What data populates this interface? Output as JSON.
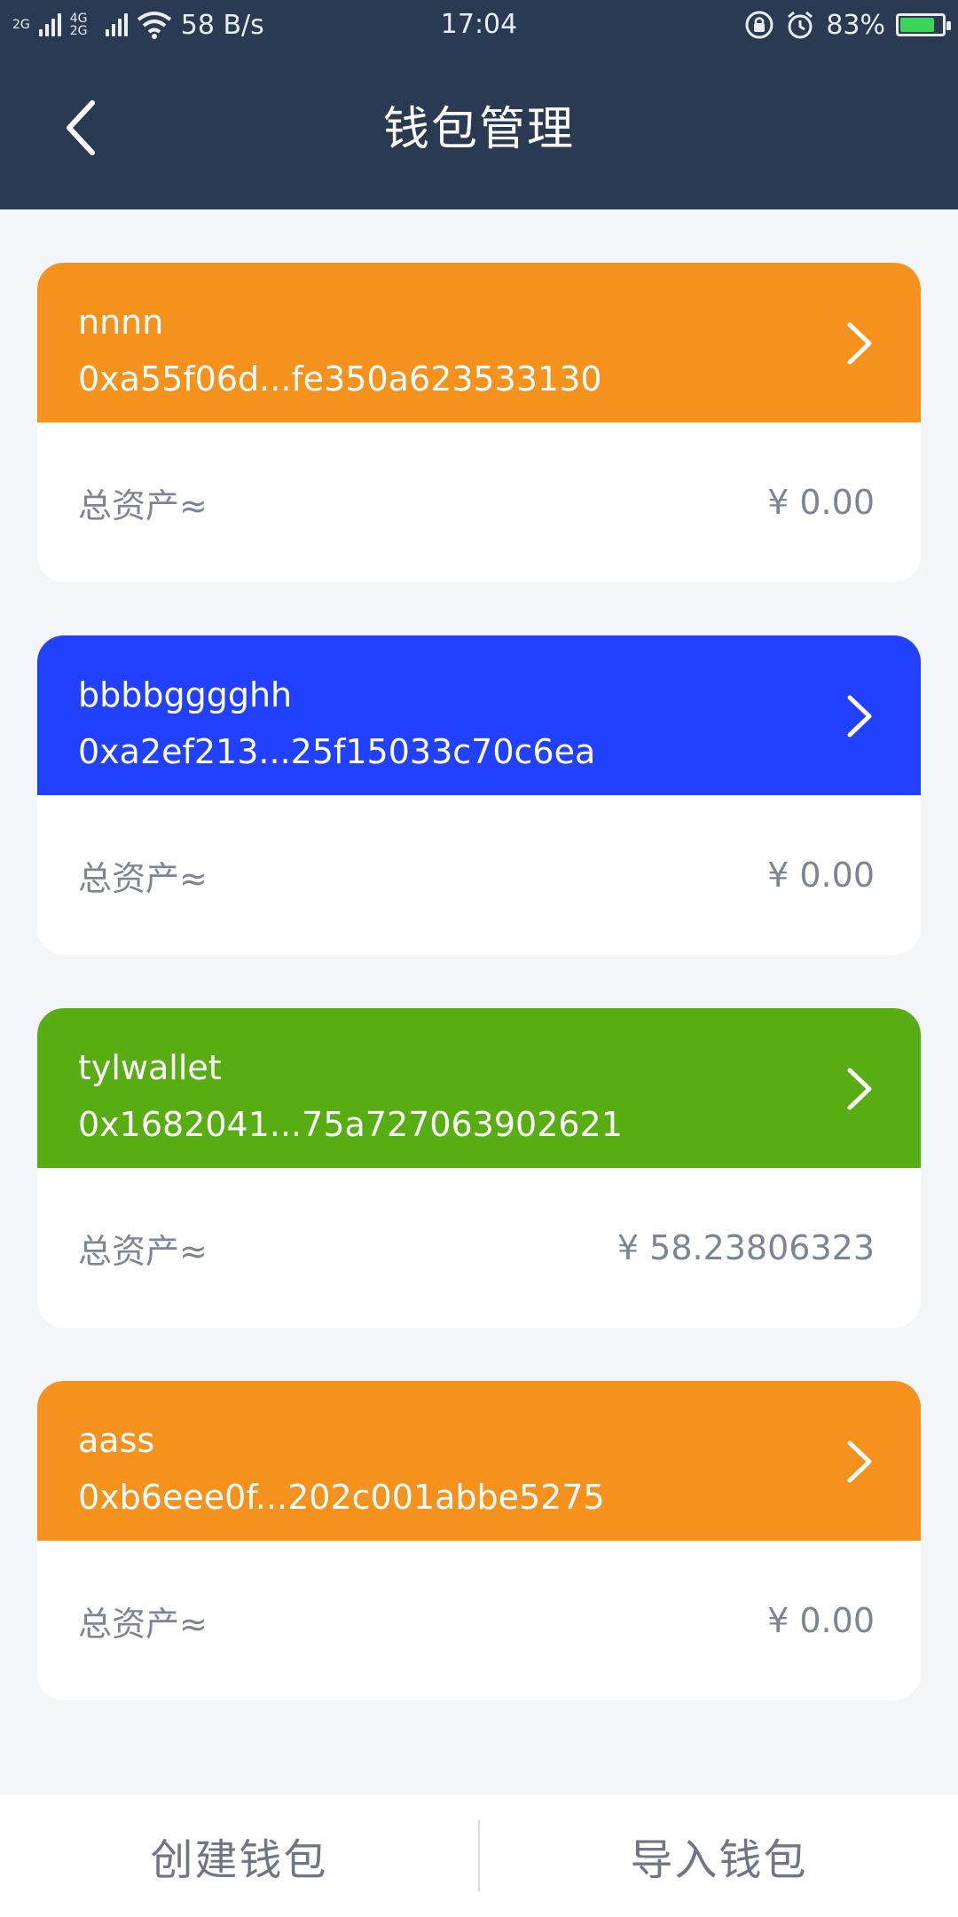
{
  "status_bar": {
    "network_1": "2G",
    "network_2": "4G 2G",
    "speed": "58 B/s",
    "time": "17:04",
    "battery_percent": "83%",
    "battery_level": 0.83,
    "icons": [
      "signal-icon",
      "wifi-icon",
      "lock-rotation-icon",
      "alarm-icon",
      "battery-icon"
    ]
  },
  "header": {
    "title": "钱包管理",
    "back_icon": "chevron-left-icon"
  },
  "wallets": [
    {
      "name": "nnnn",
      "address": "0xa55f06d...fe350a623533130",
      "assets_label": "总资产≈",
      "assets_value": "¥ 0.00",
      "color": "#f5921e"
    },
    {
      "name": "bbbbgggghh",
      "address": "0xa2ef213...25f15033c70c6ea",
      "assets_label": "总资产≈",
      "assets_value": "¥ 0.00",
      "color": "#2141ff"
    },
    {
      "name": "tylwallet",
      "address": "0x1682041...75a727063902621",
      "assets_label": "总资产≈",
      "assets_value": "¥ 58.23806323",
      "color": "#58ad13"
    },
    {
      "name": "aass",
      "address": "0xb6eee0f...202c001abbe5275",
      "assets_label": "总资产≈",
      "assets_value": "¥ 0.00",
      "color": "#f5921e"
    }
  ],
  "bottom_bar": {
    "create_label": "创建钱包",
    "import_label": "导入钱包"
  },
  "colors": {
    "header_bg": "#293a52",
    "page_bg": "#f3f6f8",
    "muted_text": "#7c8595"
  }
}
